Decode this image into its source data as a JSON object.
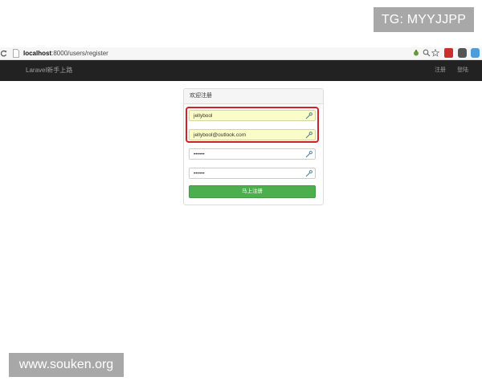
{
  "watermark": {
    "top_text": "TG: MYYJJPP",
    "bottom_text": "www.souken.org"
  },
  "browser": {
    "address_host": "localhost",
    "address_rest": ":8000/users/register",
    "icons": [
      "reload-icon",
      "page-icon",
      "extension-bug-icon",
      "search-icon",
      "star-icon",
      "extension-fb-icon",
      "pocket-icon",
      "shield-icon"
    ]
  },
  "navbar": {
    "brand": "Laravel新手上路",
    "register": "注册",
    "login": "登陆"
  },
  "form": {
    "heading": "欢迎注册",
    "username_value": "jellybool",
    "email_value": "jellybool@outlook.com",
    "password_value": "••••••",
    "confirm_value": "••••••",
    "submit_label": "马上注册"
  },
  "colors": {
    "navbar_bg": "#222222",
    "autofill_bg": "#fafcc8",
    "highlight": "#d0202a",
    "button_green": "#4cae4c"
  }
}
